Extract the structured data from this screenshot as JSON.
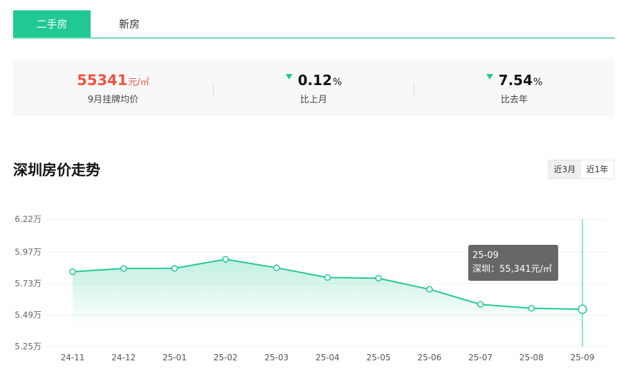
{
  "tabs": [
    {
      "label": "二手房",
      "active": true
    },
    {
      "label": "新房",
      "active": false
    }
  ],
  "stats": {
    "avg_price": {
      "value": "55341",
      "unit": "元/㎡",
      "label": "9月挂牌均价"
    },
    "mom": {
      "value": "0.12",
      "unit": "%",
      "label": "比上月",
      "direction": "down"
    },
    "yoy": {
      "value": "7.54",
      "unit": "%",
      "label": "比去年",
      "direction": "down"
    }
  },
  "section": {
    "title": "深圳房价走势"
  },
  "range": [
    {
      "label": "近3月",
      "active": true
    },
    {
      "label": "近1年",
      "active": false
    }
  ],
  "tooltip": {
    "date": "25-09",
    "text": "深圳：55,341元/㎡"
  },
  "colors": {
    "accent": "#21c893",
    "price": "#f0523f"
  },
  "chart_data": {
    "type": "area",
    "categories": [
      "24-11",
      "24-12",
      "25-01",
      "25-02",
      "25-03",
      "25-04",
      "25-05",
      "25-06",
      "25-07",
      "25-08",
      "25-09"
    ],
    "series": [
      {
        "name": "深圳",
        "values": [
          58200,
          58450,
          58460,
          59150,
          58500,
          57760,
          57700,
          56860,
          55710,
          55410,
          55341
        ]
      }
    ],
    "yticks": [
      "6.22万",
      "5.97万",
      "5.73万",
      "5.49万",
      "5.25万"
    ],
    "ytick_values": [
      62200,
      59700,
      57300,
      54900,
      52500
    ],
    "ylim": [
      52500,
      62200
    ],
    "grid": true,
    "highlight_index": 10
  }
}
